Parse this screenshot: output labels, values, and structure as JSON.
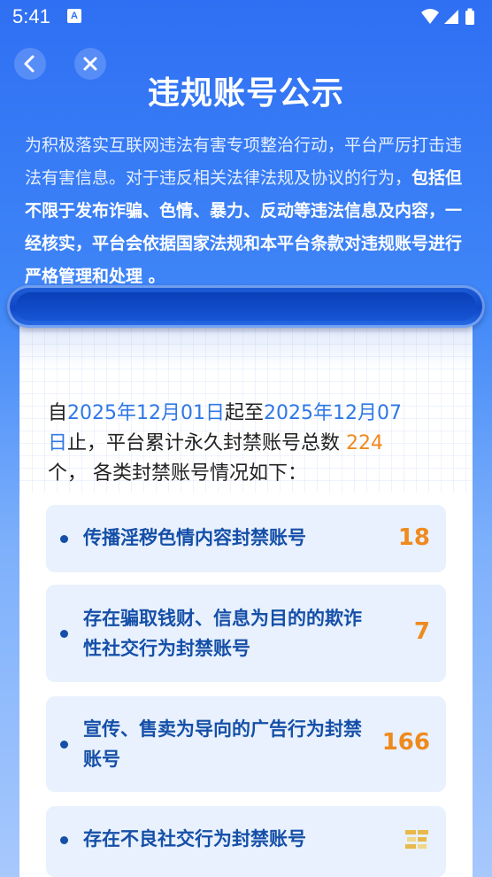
{
  "status_bar": {
    "time": "5:41",
    "notification_letter": "A"
  },
  "header": {
    "title": "违规账号公示"
  },
  "intro": {
    "text_normal": "为积极落实互联网违法有害专项整治行动，平台严厉打击违法有害信息。对于违反相关法律法规及协议的行为，",
    "text_bold": "包括但不限于发布诈骗、色情、暴力、反动等违法信息及内容，一经核实，平台会依据国家法规和本平台条款对违规账号进行严格管理和处理 。"
  },
  "summary": {
    "prefix": "自",
    "start_date": "2025年12月01日",
    "middle": "起至",
    "end_date_a": "2025年12月07",
    "end_date_b": "日",
    "text_a": "止，平台累计永久封禁账号总数 ",
    "total": "224",
    "text_b": "个， 各类封禁账号情况如下："
  },
  "categories": [
    {
      "label": "传播淫秽色情内容封禁账号",
      "count": "18"
    },
    {
      "label": "存在骗取钱财、信息为目的的欺诈性社交行为封禁账号",
      "count": "7"
    },
    {
      "label": "宣传、售卖为导向的广告行为封禁账号",
      "count": "166"
    },
    {
      "label": "存在不良社交行为封禁账号",
      "count": ""
    }
  ],
  "colors": {
    "accent_orange": "#ef8a1e",
    "label_blue": "#154fa8",
    "date_blue": "#2f78e6",
    "card_bg": "#e8f1fd"
  }
}
